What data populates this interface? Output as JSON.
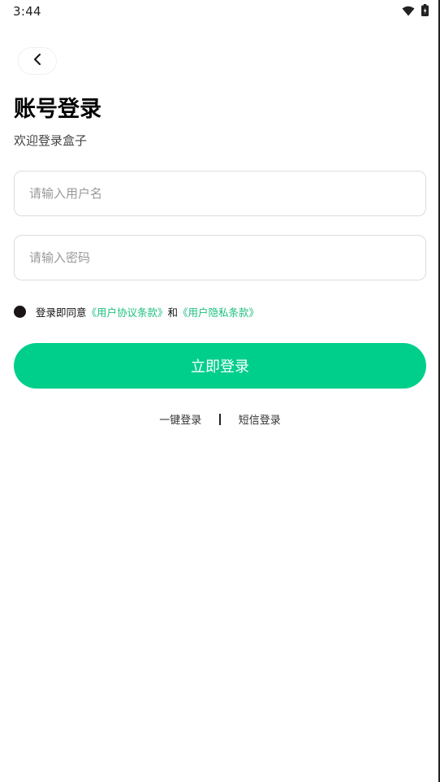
{
  "status_bar": {
    "time": "3:44",
    "wifi_icon": "wifi-icon",
    "battery_icon": "battery-icon"
  },
  "header": {
    "back_icon": "chevron-left-icon",
    "title": "账号登录",
    "subtitle": "欢迎登录盒子"
  },
  "form": {
    "username_placeholder": "请输入用户名",
    "username_value": "",
    "password_placeholder": "请输入密码",
    "password_value": ""
  },
  "agreement": {
    "prefix": "登录即同意",
    "user_agreement": "《用户协议条款》",
    "conjunction": "和",
    "privacy_policy": "《用户隐私条款》"
  },
  "actions": {
    "login_label": "立即登录",
    "one_click_login": "一键登录",
    "sms_login": "短信登录"
  },
  "colors": {
    "accent": "#00cf8c",
    "link": "#1bbf7f",
    "radio": "#1a1414"
  }
}
